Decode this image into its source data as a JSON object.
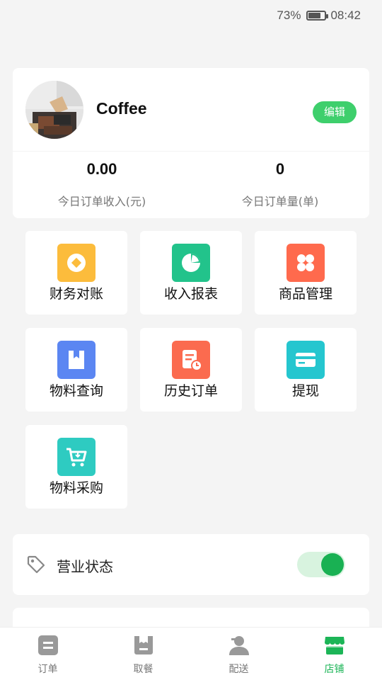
{
  "status_bar": {
    "battery": "73%",
    "time": "08:42",
    "battery_level": 0.73
  },
  "profile": {
    "store_name": "Coffee",
    "edit_label": "编辑",
    "stats": [
      {
        "value": "0.00",
        "label": "今日订单收入(元)"
      },
      {
        "value": "0",
        "label": "今日订单量(单)"
      }
    ]
  },
  "tiles": [
    {
      "label": "财务对账",
      "icon": "coin-icon",
      "color": "#fcbc3c"
    },
    {
      "label": "收入报表",
      "icon": "pie-chart-icon",
      "color": "#22c38b"
    },
    {
      "label": "商品管理",
      "icon": "grid-icon",
      "color": "#ff6a4d"
    },
    {
      "label": "物料查询",
      "icon": "bag-icon",
      "color": "#5b86f2"
    },
    {
      "label": "历史订单",
      "icon": "order-history-icon",
      "color": "#fb6b4f"
    },
    {
      "label": "提现",
      "icon": "card-icon",
      "color": "#25c6cf"
    },
    {
      "label": "物料采购",
      "icon": "cart-icon",
      "color": "#2ecbc1"
    }
  ],
  "business": {
    "label": "营业状态",
    "toggle_on": true
  },
  "tabbar": {
    "items": [
      {
        "label": "订单",
        "icon": "order-icon"
      },
      {
        "label": "取餐",
        "icon": "pickup-bag-icon"
      },
      {
        "label": "配送",
        "icon": "courier-icon"
      },
      {
        "label": "店铺",
        "icon": "store-icon"
      }
    ],
    "active_index": 3
  },
  "colors": {
    "accent": "#1cb557",
    "edit_button": "#3ecf6c",
    "background": "#f4f4f4"
  }
}
